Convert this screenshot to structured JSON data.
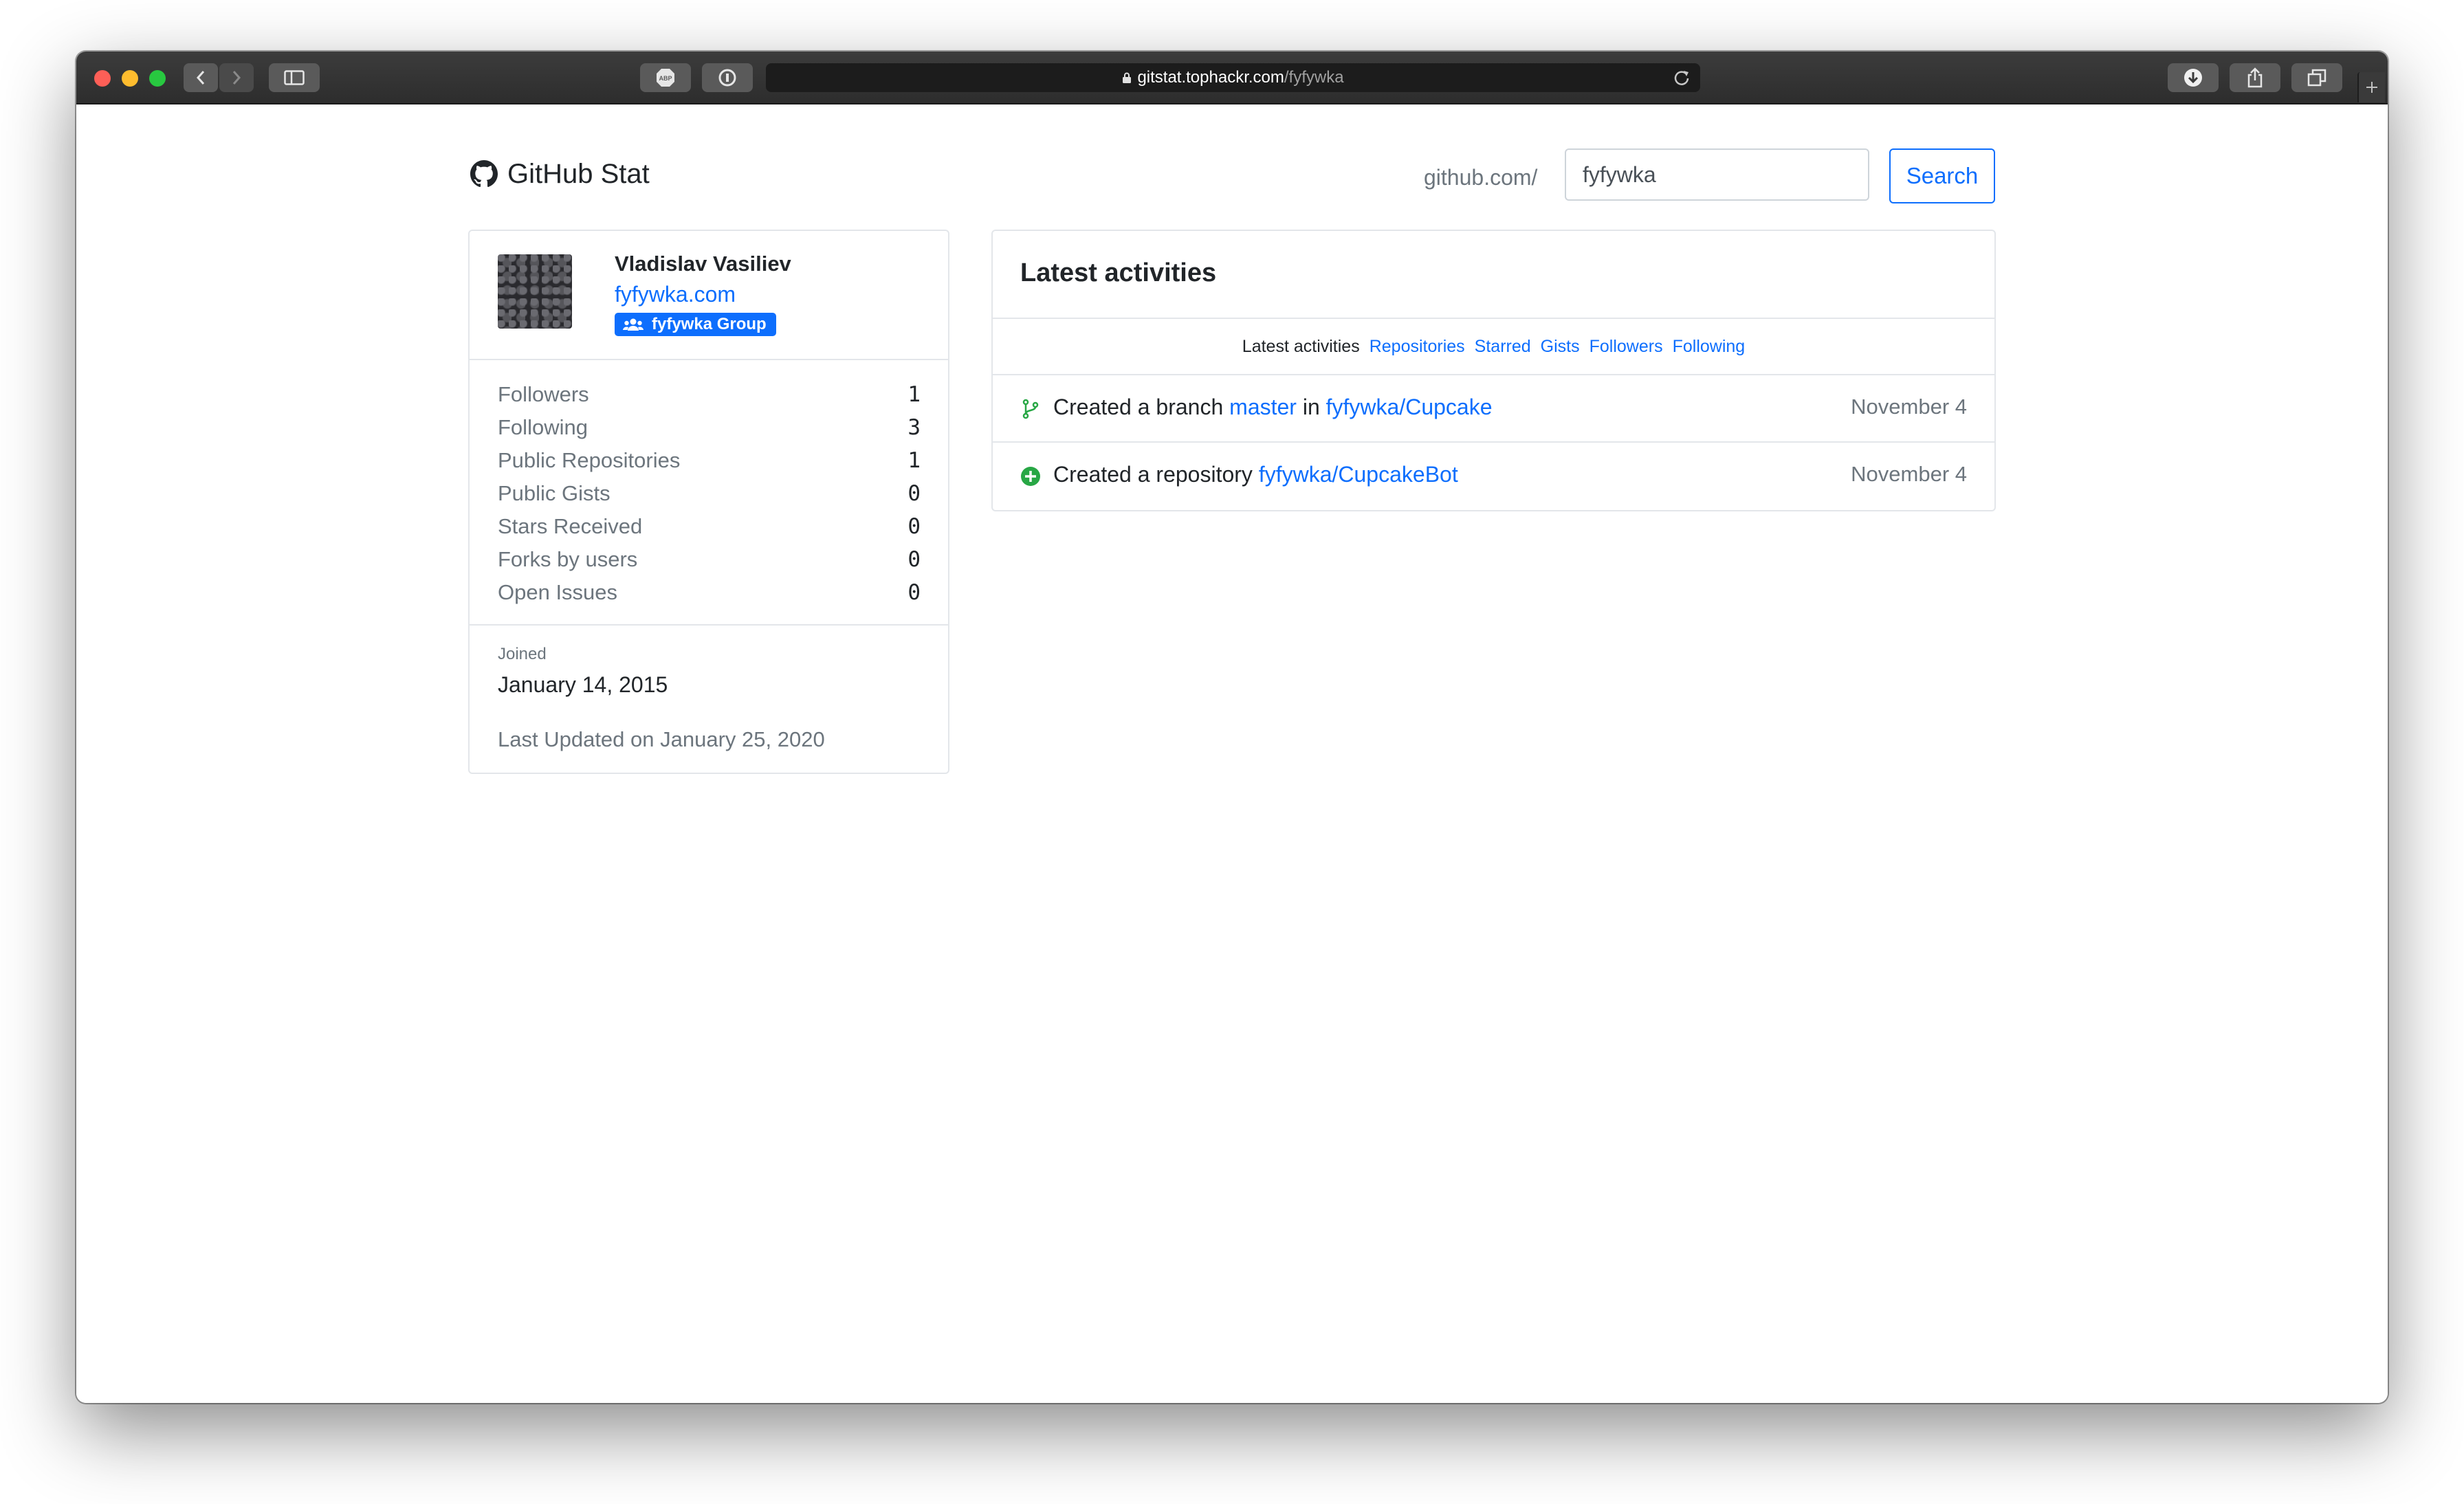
{
  "browser": {
    "url_host": "gitstat.tophackr.com",
    "url_path": "/fyfywka"
  },
  "header": {
    "brand": "GitHub Stat",
    "search_prefix": "github.com/",
    "search_value": "fyfywka",
    "search_button": "Search"
  },
  "profile": {
    "name": "Vladislav Vasiliev",
    "website": "fyfywka.com",
    "group_badge": "fyfywka Group",
    "stats": [
      {
        "label": "Followers",
        "value": "1"
      },
      {
        "label": "Following",
        "value": "3"
      },
      {
        "label": "Public Repositories",
        "value": "1"
      },
      {
        "label": "Public Gists",
        "value": "0"
      },
      {
        "label": "Stars Received",
        "value": "0"
      },
      {
        "label": "Forks by users",
        "value": "0"
      },
      {
        "label": "Open Issues",
        "value": "0"
      }
    ],
    "joined_label": "Joined",
    "joined_date": "January 14, 2015",
    "last_updated": "Last Updated on January 25, 2020"
  },
  "activities": {
    "title": "Latest activities",
    "nav": {
      "active": "Latest activities",
      "links": [
        "Repositories",
        "Starred",
        "Gists",
        "Followers",
        "Following"
      ]
    },
    "items": [
      {
        "icon": "git-branch-icon",
        "prefix": "Created a branch",
        "link1": "master",
        "middle": "in",
        "link2": "fyfywka/Cupcake",
        "date": "November 4"
      },
      {
        "icon": "plus-circle-icon",
        "prefix": "Created a repository",
        "link1": "fyfywka/CupcakeBot",
        "date": "November 4"
      }
    ]
  },
  "colors": {
    "link": "#0d6efd",
    "success_icon": "#28a745",
    "muted_text": "#6c757d"
  }
}
